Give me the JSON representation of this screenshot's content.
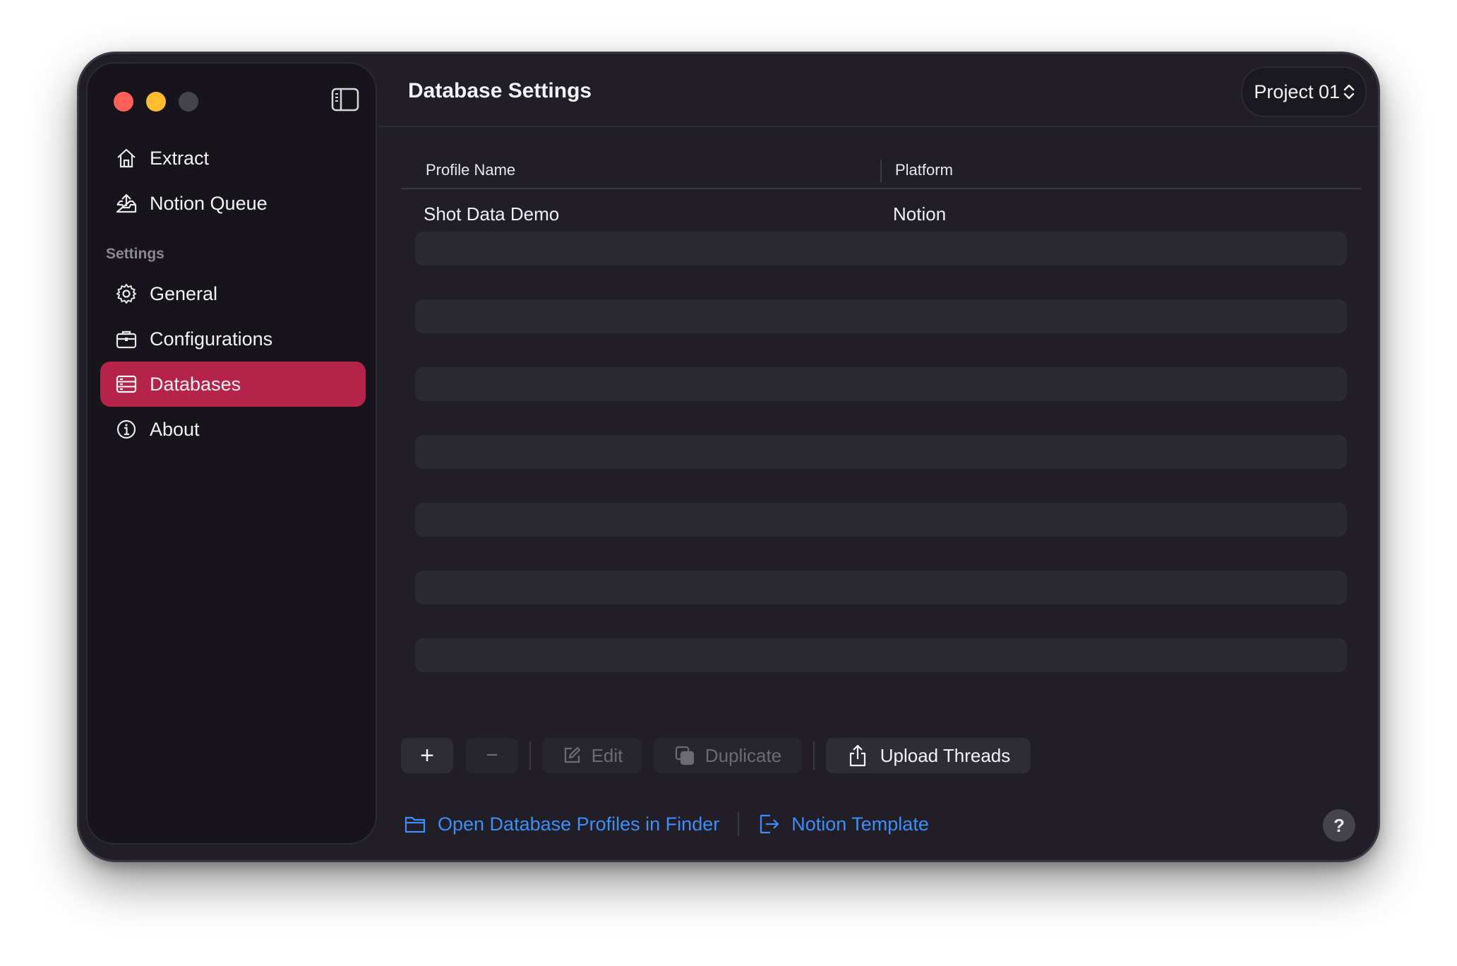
{
  "sidebar": {
    "nav": [
      {
        "label": "Extract",
        "icon": "house-icon"
      },
      {
        "label": "Notion Queue",
        "icon": "tray-upload-icon"
      }
    ],
    "section_label": "Settings",
    "settings": [
      {
        "label": "General",
        "icon": "gear-icon"
      },
      {
        "label": "Configurations",
        "icon": "briefcase-icon"
      },
      {
        "label": "Databases",
        "icon": "database-icon",
        "active": true
      },
      {
        "label": "About",
        "icon": "info-icon"
      }
    ]
  },
  "header": {
    "title": "Database Settings",
    "project": "Project 01"
  },
  "table": {
    "columns": [
      "Profile Name",
      "Platform"
    ],
    "rows": [
      {
        "profile": "Shot Data Demo",
        "platform": "Notion"
      }
    ]
  },
  "toolbar": {
    "add": "+",
    "remove": "−",
    "edit": "Edit",
    "duplicate": "Duplicate",
    "upload": "Upload Threads"
  },
  "footer": {
    "open_finder": "Open Database Profiles in Finder",
    "notion_template": "Notion Template",
    "help": "?"
  },
  "colors": {
    "accent": "#b5234b",
    "link": "#3e8ef7",
    "window_bg": "#211e27",
    "sidebar_bg": "#17151b"
  }
}
